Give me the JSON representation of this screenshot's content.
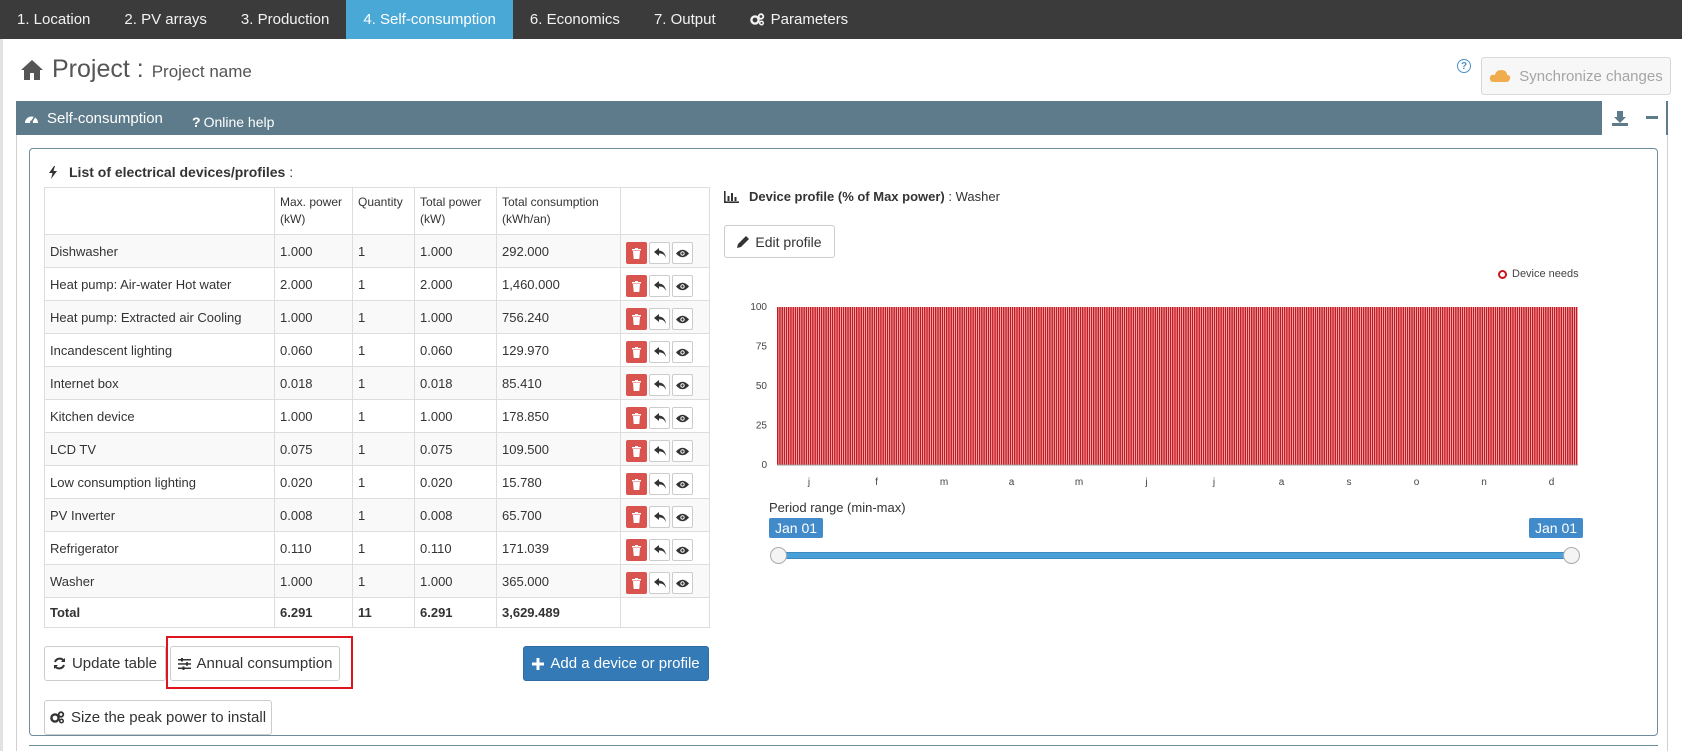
{
  "nav": {
    "tabs": [
      {
        "label": "1. Location"
      },
      {
        "label": "2. PV arrays"
      },
      {
        "label": "3. Production"
      },
      {
        "label": "4. Self-consumption"
      },
      {
        "label": "6. Economics"
      },
      {
        "label": "7. Output"
      },
      {
        "label": "Parameters",
        "icon": "gears-icon"
      }
    ],
    "active_tab": "4. Self-consumption",
    "active_color": "#4aa8d6",
    "bar_color": "#3b3b3b"
  },
  "header": {
    "project_label": "Project :",
    "project_name": "Project name",
    "help_symbol": "?",
    "sync_label": "Synchronize changes"
  },
  "panel": {
    "title": "Self-consumption",
    "help_label": "Online help",
    "header_color": "#5d7b8a"
  },
  "devices": {
    "title": "List of electrical devices/profiles",
    "title_suffix": ":",
    "columns": {
      "max_power": "Max. power (kW)",
      "quantity": "Quantity",
      "total_power": "Total power (kW)",
      "total_consumption": "Total consumption (kWh/an)"
    },
    "rows": [
      {
        "name": "Dishwasher",
        "max_power": "1.000",
        "quantity": "1",
        "total_power": "1.000",
        "total_consumption": "292.000"
      },
      {
        "name": "Heat pump: Air-water Hot water",
        "max_power": "2.000",
        "quantity": "1",
        "total_power": "2.000",
        "total_consumption": "1,460.000"
      },
      {
        "name": "Heat pump: Extracted air Cooling",
        "max_power": "1.000",
        "quantity": "1",
        "total_power": "1.000",
        "total_consumption": "756.240"
      },
      {
        "name": "Incandescent lighting",
        "max_power": "0.060",
        "quantity": "1",
        "total_power": "0.060",
        "total_consumption": "129.970"
      },
      {
        "name": "Internet box",
        "max_power": "0.018",
        "quantity": "1",
        "total_power": "0.018",
        "total_consumption": "85.410"
      },
      {
        "name": "Kitchen device",
        "max_power": "1.000",
        "quantity": "1",
        "total_power": "1.000",
        "total_consumption": "178.850"
      },
      {
        "name": "LCD TV",
        "max_power": "0.075",
        "quantity": "1",
        "total_power": "0.075",
        "total_consumption": "109.500"
      },
      {
        "name": "Low consumption lighting",
        "max_power": "0.020",
        "quantity": "1",
        "total_power": "0.020",
        "total_consumption": "15.780"
      },
      {
        "name": "PV Inverter",
        "max_power": "0.008",
        "quantity": "1",
        "total_power": "0.008",
        "total_consumption": "65.700"
      },
      {
        "name": "Refrigerator",
        "max_power": "0.110",
        "quantity": "1",
        "total_power": "0.110",
        "total_consumption": "171.039"
      },
      {
        "name": "Washer",
        "max_power": "1.000",
        "quantity": "1",
        "total_power": "1.000",
        "total_consumption": "365.000"
      }
    ],
    "total": {
      "label": "Total",
      "max_power": "6.291",
      "quantity": "11",
      "total_power": "6.291",
      "total_consumption": "3,629.489"
    },
    "row_action_icons": [
      "trash-icon",
      "undo-icon",
      "eye-icon"
    ]
  },
  "buttons": {
    "update_table": "Update table",
    "annual_consumption": "Annual consumption",
    "add_device": "Add a device or profile",
    "size_peak": "Size the peak power to install"
  },
  "profile": {
    "title": "Device profile (% of Max power)",
    "separator": ":",
    "device": "Washer",
    "edit_label": "Edit profile",
    "legend": "Device needs",
    "period_label": "Period range (min-max)",
    "range_min": "Jan 01",
    "range_max": "Jan 01"
  },
  "chart_data": {
    "type": "bar",
    "title": "",
    "xlabel": "",
    "ylabel": "",
    "x_tick_labels": [
      "j",
      "f",
      "m",
      "a",
      "m",
      "j",
      "j",
      "a",
      "s",
      "o",
      "n",
      "d"
    ],
    "y_ticks": [
      0,
      25,
      50,
      75,
      100
    ],
    "ylim": [
      0,
      100
    ],
    "series": [
      {
        "name": "Device needs",
        "color": "#c8161d",
        "bar_count": 365,
        "value": 100
      }
    ],
    "grid": false,
    "legend_position": "top-right"
  }
}
